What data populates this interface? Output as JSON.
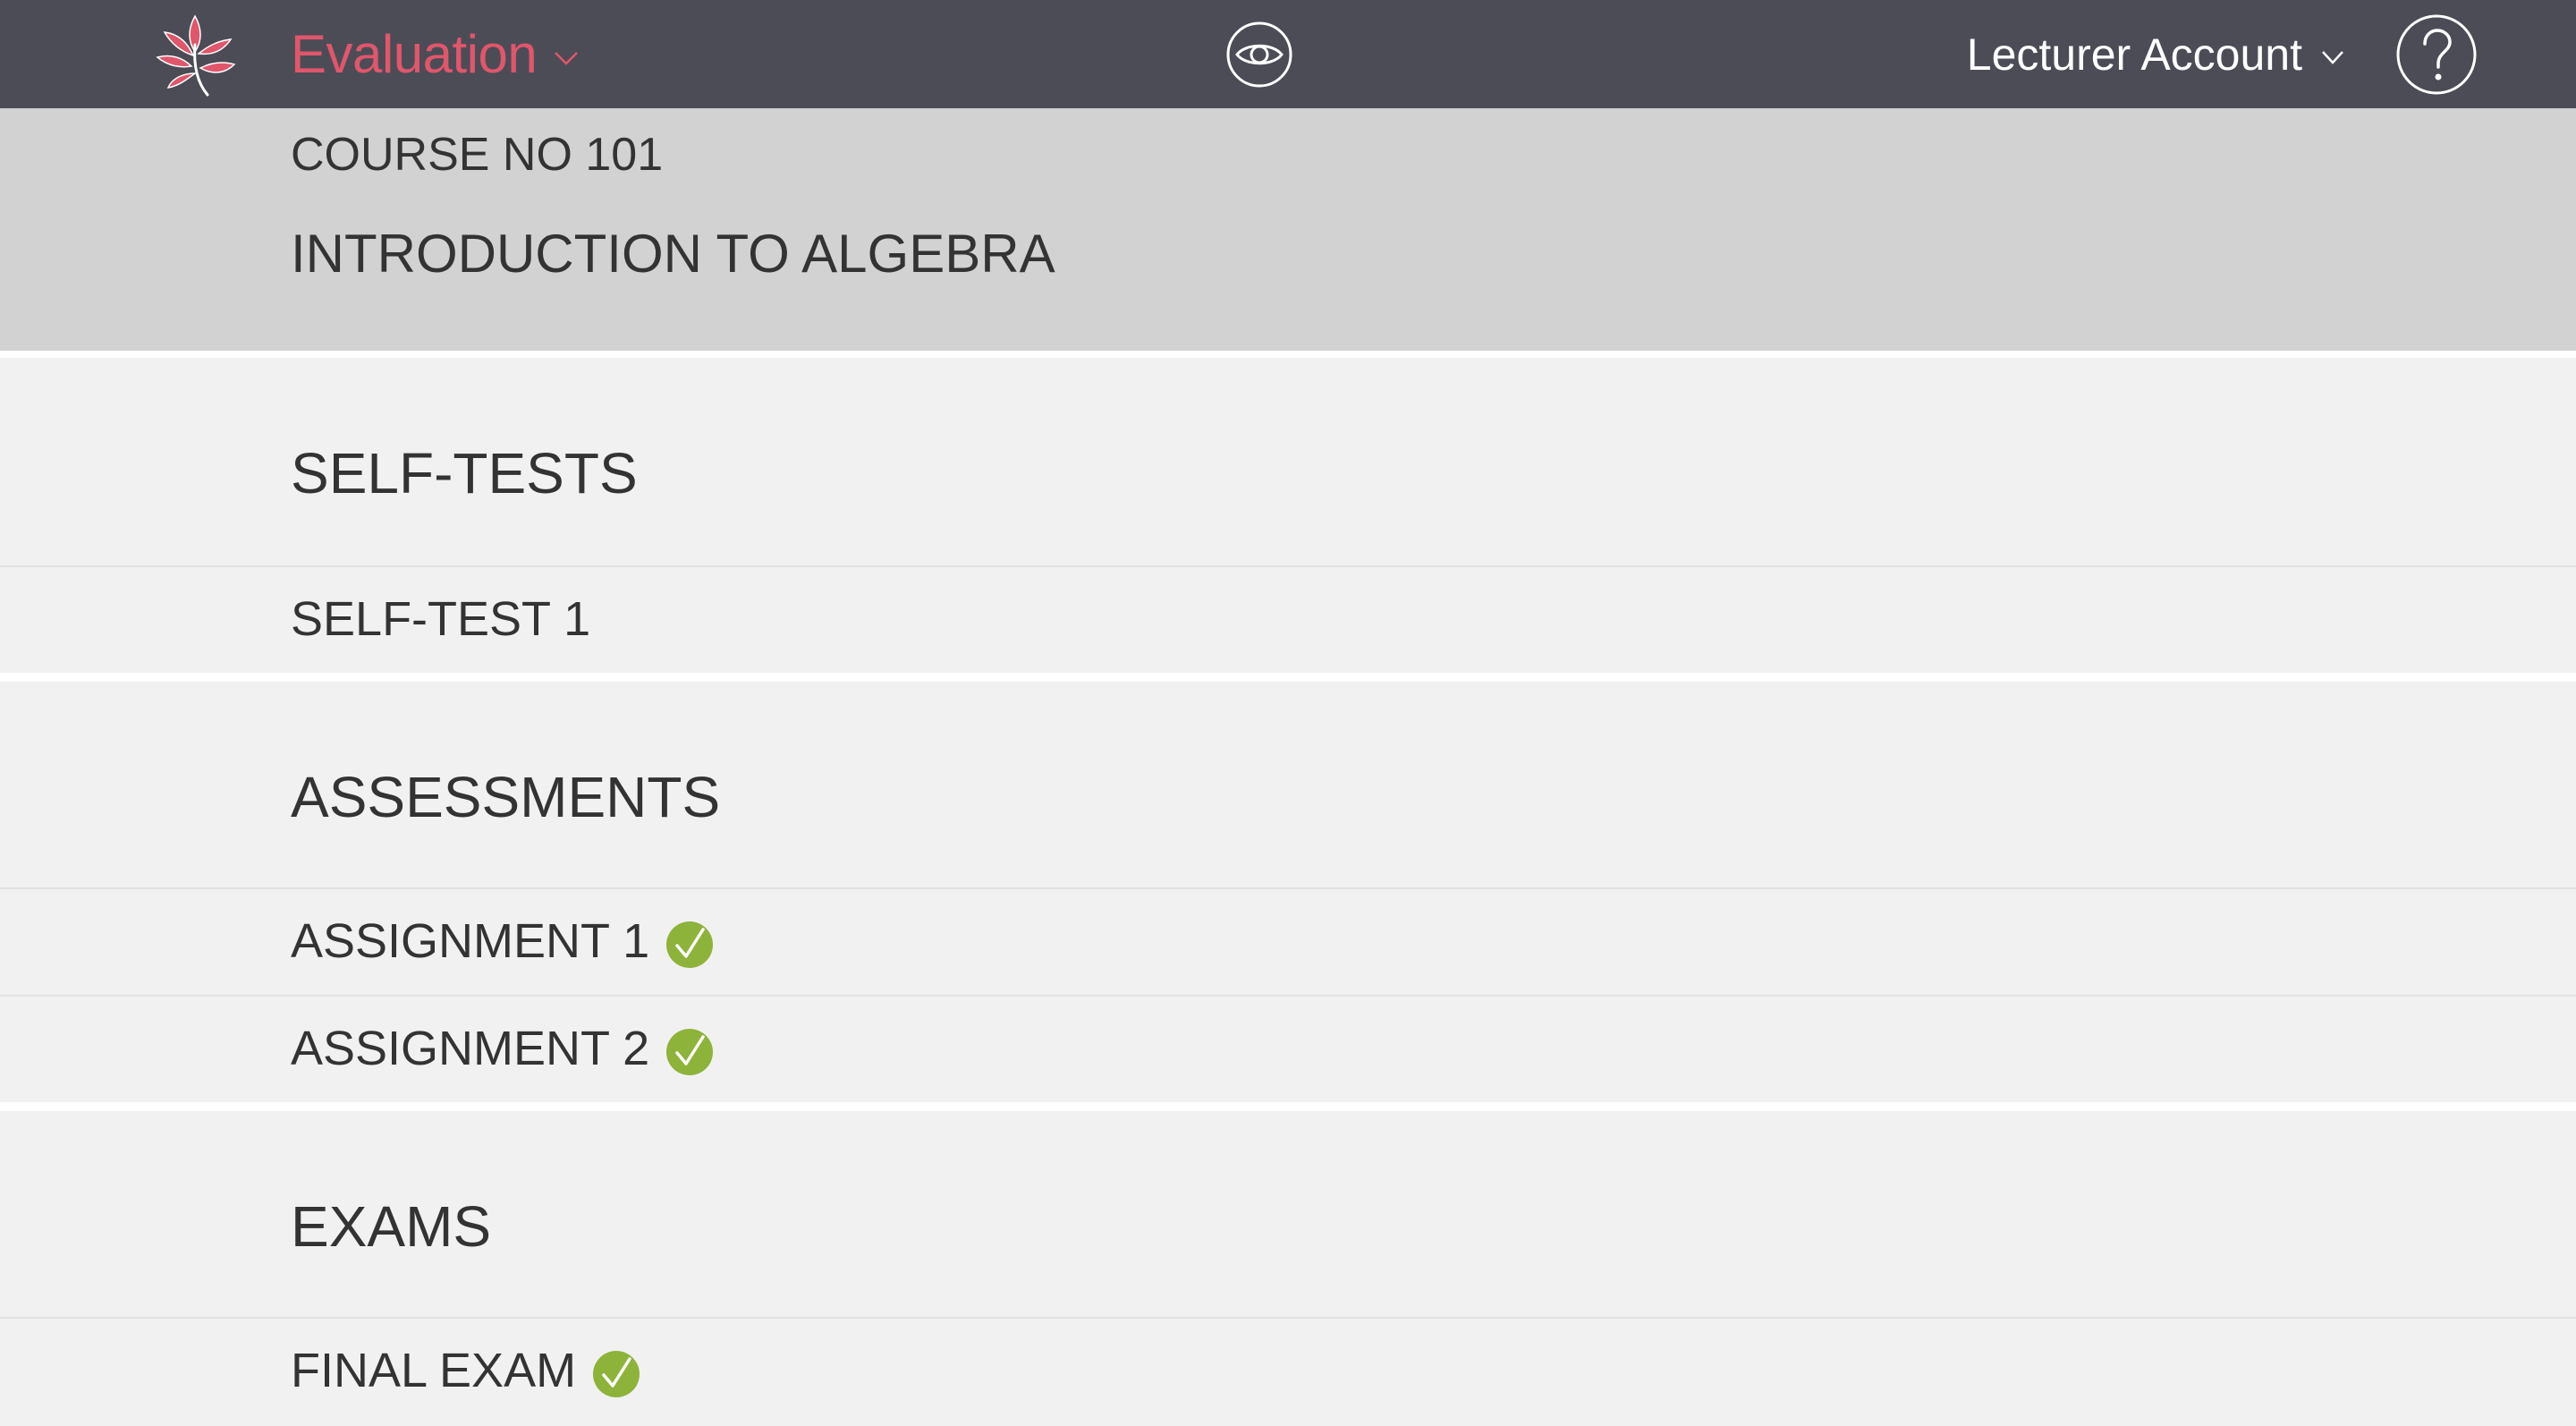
{
  "topbar": {
    "logo_icon": "leaf-branch-icon",
    "app_title": "Evaluation",
    "app_menu_icon": "chevron-down-icon",
    "preview_icon": "eye-icon",
    "account_label": "Lecturer Account",
    "account_menu_icon": "chevron-down-icon",
    "help_icon": "question-mark-icon"
  },
  "course": {
    "number": "COURSE NO 101",
    "title": "INTRODUCTION TO ALGEBRA"
  },
  "sections": [
    {
      "title": "SELF-TESTS",
      "items": [
        {
          "label": "SELF-TEST 1",
          "completed": false
        }
      ]
    },
    {
      "title": "ASSESSMENTS",
      "items": [
        {
          "label": "ASSIGNMENT 1",
          "completed": true
        },
        {
          "label": "ASSIGNMENT 2",
          "completed": true
        }
      ]
    },
    {
      "title": "EXAMS",
      "items": [
        {
          "label": "FINAL EXAM",
          "completed": true
        }
      ]
    }
  ],
  "colors": {
    "topbar_bg": "#4c4c57",
    "accent": "#e0566b",
    "course_header_bg": "#d2d2d2",
    "section_bg": "#f1f1f1",
    "check_green": "#8db33a"
  }
}
